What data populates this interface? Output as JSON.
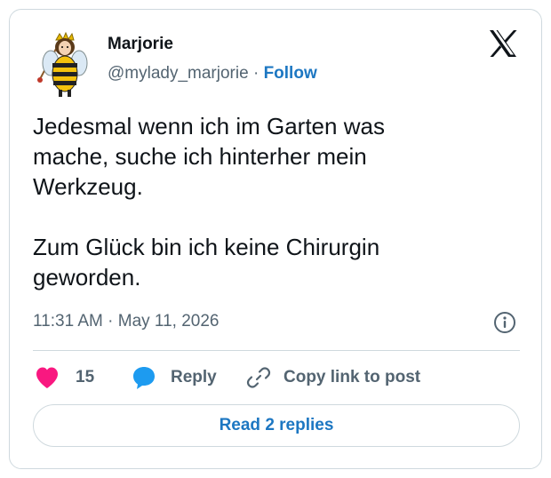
{
  "author": {
    "name": "Marjorie",
    "handle": "@mylady_marjorie",
    "separator": "·",
    "follow_label": "Follow"
  },
  "tweet": {
    "text": "Jedesmal wenn ich im Garten was\nmache, suche ich hinterher mein\nWerkzeug.\n\nZum Glück bin ich keine Chirurgin\ngeworden.",
    "timestamp": "11:31 AM · May 11, 2026"
  },
  "actions": {
    "like_count": "15",
    "reply_label": "Reply",
    "copy_label": "Copy link to post"
  },
  "read_replies_label": "Read 2 replies",
  "icons": {
    "logo": "x-logo-icon",
    "info": "info-icon",
    "like": "heart-icon",
    "reply": "speech-bubble-icon",
    "copy": "link-icon"
  },
  "colors": {
    "heart": "#f91880",
    "reply_bubble": "#1d9bf0",
    "link_blue": "#1d77c2",
    "secondary_text": "#536471",
    "border": "#cfd9de"
  }
}
